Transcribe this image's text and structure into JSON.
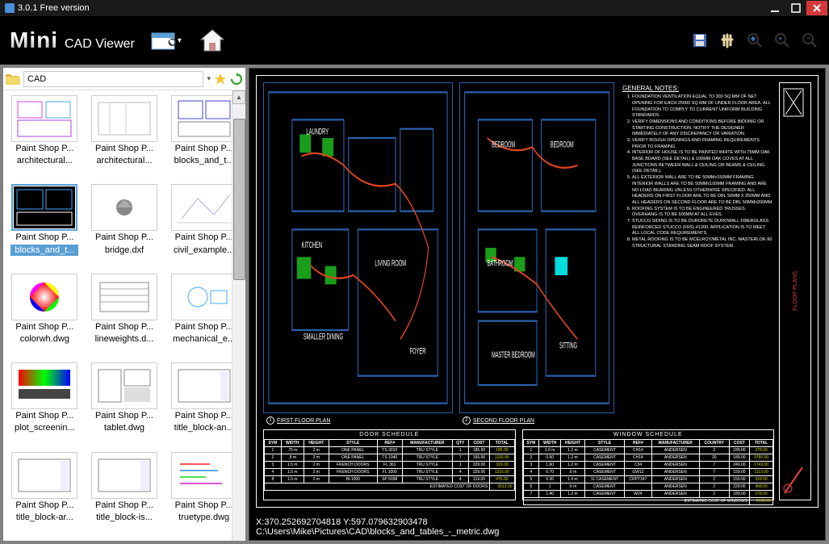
{
  "title": "3.0.1 Free version",
  "logo": {
    "main": "Mini",
    "sub": "CAD Viewer"
  },
  "folder": "CAD",
  "thumbs": [
    {
      "type": "Paint Shop P...",
      "file": "architectural..."
    },
    {
      "type": "Paint Shop P...",
      "file": "architectural..."
    },
    {
      "type": "Paint Shop P...",
      "file": "blocks_and_t..."
    },
    {
      "type": "Paint Shop P...",
      "file": "blocks_and_t...",
      "selected": true
    },
    {
      "type": "Paint Shop P...",
      "file": "bridge.dxf"
    },
    {
      "type": "Paint Shop P...",
      "file": "civil_example..."
    },
    {
      "type": "Paint Shop P...",
      "file": "colorwh.dwg"
    },
    {
      "type": "Paint Shop P...",
      "file": "lineweights.d..."
    },
    {
      "type": "Paint Shop P...",
      "file": "mechanical_e..."
    },
    {
      "type": "Paint Shop P...",
      "file": "plot_screenin..."
    },
    {
      "type": "Paint Shop P...",
      "file": "tablet.dwg"
    },
    {
      "type": "Paint Shop P...",
      "file": "title_block-an..."
    },
    {
      "type": "Paint Shop P...",
      "file": "title_block-ar..."
    },
    {
      "type": "Paint Shop P...",
      "file": "title_block-is..."
    },
    {
      "type": "Paint Shop P...",
      "file": "truetype.dwg"
    }
  ],
  "drawing": {
    "plan1": "FIRST FLOOR PLAN",
    "plan2": "SECOND FLOOR PLAN",
    "notes_title": "GENERAL NOTES:",
    "notes": [
      "FOUNDATION VENTILATION EQUAL TO 300 SQ MM OF NET OPENING FOR EACH 25000 SQ MM OF UNDER FLOOR AREA. ALL FOUNDATION TO COMPLY TO CURRENT UNIFORM BUILDING STANDARDS.",
      "VERIFY DIMENSIONS AND CONDITIONS BEFORE BIDDING OR STARTING CONSTRUCTION. NOTIFY THE DESIGNER IMMEDIATELY OF ANY DISCREPANCY OR VARIATION.",
      "VERIFY ROUGH OPENINGS AND FRAMING REQUIREMENTS PRIOR TO FRAMING.",
      "INTERIOR OF HOUSE IS TO BE PAINTED WHITE WITH 75MM OAK BASE BOARD (SEE DETAIL) & 100MM OAK COVES AT ALL JUNCTIONS BETWEEN WALL & CEILING OR BEAMS & CEILING (SEE DETAIL).",
      "ALL EXTERIOR WALL ARE TO BE 50MMx150MM FRAMING. INTERIOR WALLS ARE TO BE 50MMx100MM FRAMING AND ARE NO LOAD BEARING UNLESS OTHERWISE SPECIFIED. ALL HEADERS ON FIRST FLOOR ARE TO BE DBL 50MM X 250MM AND ALL HEADERS ON SECOND FLOOR ARE TO BE DBL 50MMx200MM",
      "ROOFING SYSTEM IS TO BE ENGINEERED TRUSSES. OVERHANG IS TO BE 600MM AT ALL EVES.",
      "STUCCO SIDING IS TO BE DURORETE DUROWALL FIBERGLASS REINFORCED STUCCO (FRS) #1200. APPLICATION IS TO MEET ALL LOCAL CODE REQUIREMENTS.",
      "METAL ROOFING IS TO BE MCELROY/METAL INC. MASTERLOK-90 STRUCTURAL STANDING SEAM ROOF SYSTEM."
    ],
    "door_sched": {
      "title": "DOOR SCHEDULE",
      "headers": [
        "SYM",
        "WIDTH",
        "HEIGHT",
        "STYLE",
        "REF#",
        "MANUFACTURER",
        "QTY",
        "COST",
        "TOTAL"
      ],
      "rows": [
        [
          "1",
          ".75 m",
          "2 m",
          "ONE PANEL",
          "TS 3010",
          "TRU STYLE",
          "1",
          "185.00",
          "185.00"
        ],
        [
          "2",
          ".8 m",
          "2 m",
          "ONE PANEL",
          "TS 1040",
          "TRU STYLE",
          "7",
          "165.00",
          "1155.00"
        ],
        [
          "3",
          "1.5 m",
          "2 m",
          "FRENCH DOORS",
          "FL 361",
          "TRU STYLE",
          "1",
          "329.00",
          "329.00"
        ],
        [
          "4",
          "1.5 m",
          "2 m",
          "FRENCH DOORS",
          "FL 1000",
          "TRU STYLE",
          "4",
          "329.00",
          "1316.00"
        ],
        [
          "8",
          "1.5 m",
          "2 m",
          "BI-1000",
          "SP 5098",
          "TRU STYLE",
          "4",
          "119.00",
          "476.00"
        ]
      ],
      "footer": "ESTIMATED COST OF DOORS",
      "total": "3513.00"
    },
    "window_sched": {
      "title": "WINDOW SCHEDULE",
      "headers": [
        "SYM",
        "WIDTH",
        "HEIGHT",
        "STYLE",
        "REF#",
        "MANUFACTURER",
        "COUNTRY",
        "COST",
        "TOTAL"
      ],
      "rows": [
        [
          "1",
          "1.0 m",
          "1.2 m",
          "CASEMENT",
          "CH14",
          "ANDERSEN",
          "2",
          "189.00",
          "378.00"
        ],
        [
          "2",
          "0.50",
          "1.2 m",
          "CASEMENT",
          "CH14",
          "ANDERSEN",
          "20",
          "189.00",
          "3780.00"
        ],
        [
          "3",
          "1.60",
          "1.2 m",
          "CASEMENT",
          "C34",
          "ANDERSEN",
          "7",
          "249.00",
          "1743.00"
        ],
        [
          "4",
          "0.70",
          ".6 m",
          "CASEMENT",
          "GW12",
          "ANDERSEN",
          "7",
          "159.00",
          "1113.00"
        ],
        [
          "5",
          "0.30",
          "1.4 m",
          "11 CASEMENT",
          "CRPT347",
          "ANDERSEN",
          "2",
          "159.00",
          "318.00"
        ],
        [
          "6",
          "1",
          ".6 m",
          "CASEMENT",
          "",
          "ANDERSEN",
          "2",
          "229.00",
          "458.00"
        ],
        [
          "7",
          "1.40",
          "1.2 m",
          "CASEMENT",
          "W24",
          "ANDERSEN",
          "2",
          "189.00",
          "378.00"
        ]
      ],
      "footer": "ESTIMATED COST OF WINDOWS",
      "total": "8150.00"
    },
    "title_strip": "FLOOR PLANS"
  },
  "status": {
    "coords": "X:370.252692704818 Y:597.079632903478",
    "path": "C:\\Users\\Mike\\Pictures\\CAD\\blocks_and_tables_-_metric.dwg"
  }
}
